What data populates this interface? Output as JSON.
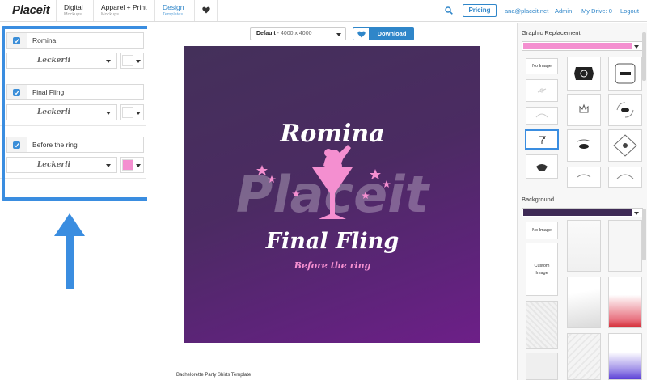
{
  "nav": {
    "logo": "Placeit",
    "tabs": [
      {
        "label": "Digital",
        "sub": "Mockups"
      },
      {
        "label": "Apparel + Print",
        "sub": "Mockups"
      },
      {
        "label": "Design",
        "sub": "Templates"
      }
    ],
    "pricing": "Pricing",
    "email": "ana@placeit.net",
    "admin": "Admin",
    "drive": "My Drive: 0",
    "logout": "Logout"
  },
  "layers": [
    {
      "text": "Romina",
      "font": "Leckerli",
      "color": "#ffffff"
    },
    {
      "text": "Final Fling",
      "font": "Leckerli",
      "color": "#ffffff"
    },
    {
      "text": "Before the ring",
      "font": "Leckerli",
      "color": "#f48fd0"
    }
  ],
  "toolbar": {
    "size_label": "Default",
    "size_dims": " - 4000 x 4000",
    "download": "Download"
  },
  "mockup": {
    "line1": "Romina",
    "line2": "Final Fling",
    "line3": "Before the ring",
    "watermark": "Placeit",
    "text_color": "#ffffff",
    "accent_color": "#f48fd0"
  },
  "template_title": "Bachelorette Party Shirts Template",
  "graphic_replacement": {
    "title": "Graphic Replacement",
    "color": "#f48fd0",
    "no_image": "No Image"
  },
  "background": {
    "title": "Background",
    "color": "#3e2a55",
    "no_image": "No Image",
    "custom_image": "Custom Image"
  },
  "colors": {
    "accent": "#2f86c9",
    "highlight": "#3a8de0"
  }
}
